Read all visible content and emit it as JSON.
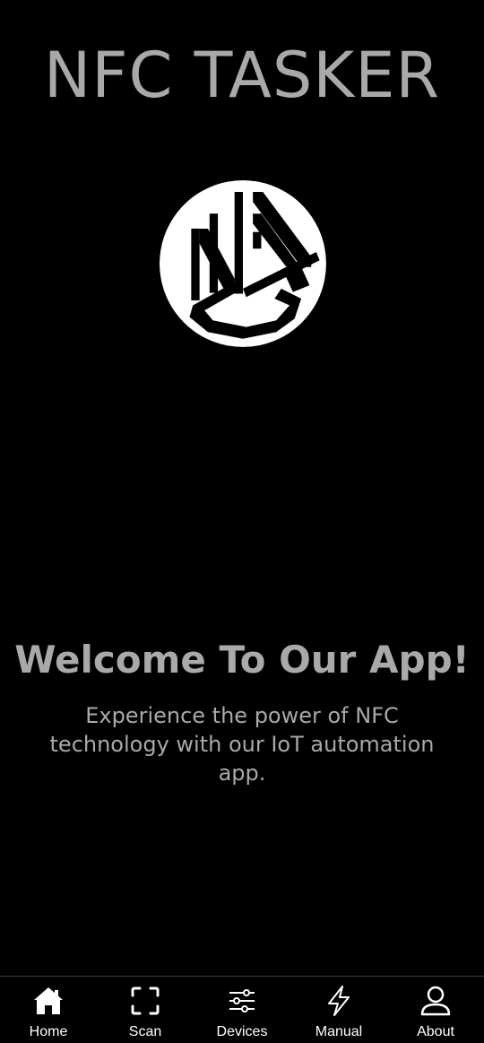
{
  "header": {
    "title": "NFC TASKER"
  },
  "logo": {
    "icon": "nfc-logo-icon",
    "color": "#ffffff"
  },
  "welcome": {
    "title": "Welcome To Our App!",
    "text": "Experience the power of NFC technology with our IoT automation app."
  },
  "nav": {
    "items": [
      {
        "label": "Home",
        "icon": "home-icon"
      },
      {
        "label": "Scan",
        "icon": "scan-icon"
      },
      {
        "label": "Devices",
        "icon": "sliders-icon"
      },
      {
        "label": "Manual",
        "icon": "lightning-icon"
      },
      {
        "label": "About",
        "icon": "user-icon"
      }
    ]
  },
  "colors": {
    "background": "#000000",
    "text_muted": "#a9a9a9",
    "nav_text": "#ffffff",
    "nav_divider": "#3a3a3a"
  }
}
